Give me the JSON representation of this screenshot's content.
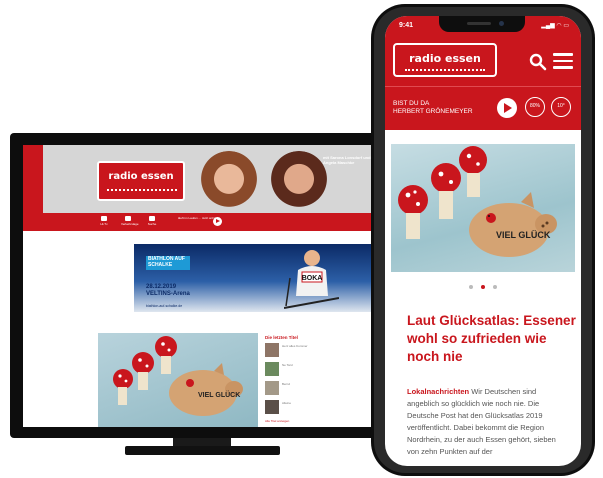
{
  "desktop": {
    "logo_text": "radio essen",
    "header_tagline": "mit Sarona Lonsdorf und Angela Maschke",
    "nav": [
      {
        "label": "Hi-Tv",
        "icon": "headphones-icon"
      },
      {
        "label": "Verkehrslage",
        "icon": "car-icon"
      },
      {
        "label": "Suche",
        "icon": "search-icon"
      }
    ],
    "now_playing": "läuft im Laufen ... Jetzt anhören",
    "banner": {
      "badge": "BIATHLON AUF SCHALKE",
      "date": "28.12.2019",
      "venue": "VELTINS-Arena",
      "url": "biathlon-auf-schalke.de",
      "bib": "BOKA"
    },
    "feature_caption": "VIEL GLÜCK",
    "side_title": "Die letzten Titel",
    "side_items": [
      {
        "text": "Herz alles Kummer"
      },
      {
        "text": "Ne Tanz"
      },
      {
        "text": "Bernd"
      },
      {
        "text": "Alleine"
      }
    ],
    "side_footer": "Alle Titel anzeigen"
  },
  "mobile": {
    "status_time": "9:41",
    "status_icons": "▂▄▆ ◠ ▭",
    "logo_text": "radio essen",
    "player_title_line1": "BIST DU DA",
    "player_title_line2": "HERBERT GRÖNEMEYER",
    "player_icons": [
      {
        "label": "80%"
      },
      {
        "label": "10°"
      }
    ],
    "hero_caption": "VIEL GLÜCK",
    "headline": "Laut Glücksatlas: Essener wohl so zufrieden wie noch nie",
    "category": "Lokalnachrichten",
    "body": "Wir Deutschen sind angeblich so glücklich wie noch nie. Die Deutsche Post hat den Glücksatlas 2019 veröffentlicht. Dabei bekommt die Region Nordrhein, zu der auch Essen gehört, sieben von zehn Punkten auf der"
  },
  "colors": {
    "brand_red": "#c9161d",
    "device_black": "#0e0e0e"
  }
}
